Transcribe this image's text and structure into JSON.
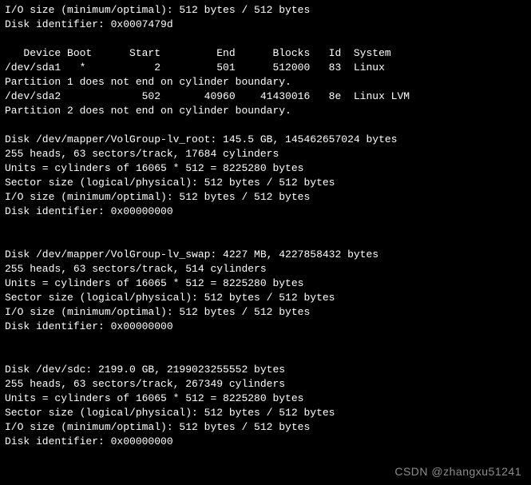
{
  "intro": {
    "io_size": "I/O size (minimum/optimal): 512 bytes / 512 bytes",
    "disk_id": "Disk identifier: 0x0007479d"
  },
  "partition_table": {
    "header": "   Device Boot      Start         End      Blocks   Id  System",
    "row1": "/dev/sda1   *           2         501      512000   83  Linux",
    "warn1": "Partition 1 does not end on cylinder boundary.",
    "row2": "/dev/sda2             502       40960    41430016   8e  Linux LVM",
    "warn2": "Partition 2 does not end on cylinder boundary."
  },
  "disk_lvroot": {
    "title": "Disk /dev/mapper/VolGroup-lv_root: 145.5 GB, 145462657024 bytes",
    "geom": "255 heads, 63 sectors/track, 17684 cylinders",
    "units": "Units = cylinders of 16065 * 512 = 8225280 bytes",
    "sector": "Sector size (logical/physical): 512 bytes / 512 bytes",
    "io": "I/O size (minimum/optimal): 512 bytes / 512 bytes",
    "id": "Disk identifier: 0x00000000"
  },
  "disk_lvswap": {
    "title": "Disk /dev/mapper/VolGroup-lv_swap: 4227 MB, 4227858432 bytes",
    "geom": "255 heads, 63 sectors/track, 514 cylinders",
    "units": "Units = cylinders of 16065 * 512 = 8225280 bytes",
    "sector": "Sector size (logical/physical): 512 bytes / 512 bytes",
    "io": "I/O size (minimum/optimal): 512 bytes / 512 bytes",
    "id": "Disk identifier: 0x00000000"
  },
  "disk_sdc": {
    "title": "Disk /dev/sdc: 2199.0 GB, 2199023255552 bytes",
    "geom": "255 heads, 63 sectors/track, 267349 cylinders",
    "units": "Units = cylinders of 16065 * 512 = 8225280 bytes",
    "sector": "Sector size (logical/physical): 512 bytes / 512 bytes",
    "io": "I/O size (minimum/optimal): 512 bytes / 512 bytes",
    "id": "Disk identifier: 0x00000000"
  },
  "watermark": "CSDN @zhangxu51241"
}
